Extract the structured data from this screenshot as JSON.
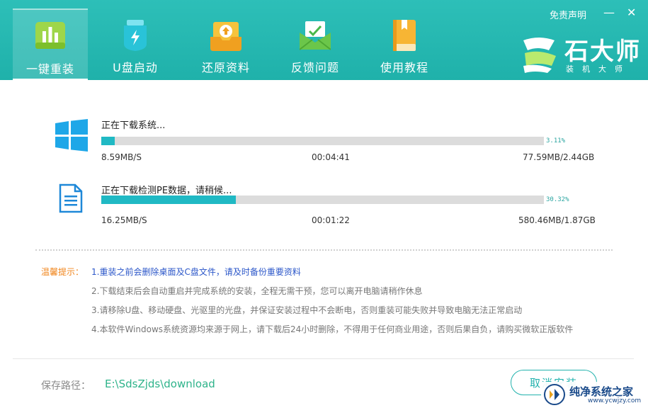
{
  "header": {
    "tabs": [
      {
        "label": "一键重装",
        "icon": "bar-chart-icon",
        "active": true
      },
      {
        "label": "U盘启动",
        "icon": "usb-drive-icon",
        "active": false
      },
      {
        "label": "还原资料",
        "icon": "restore-icon",
        "active": false
      },
      {
        "label": "反馈问题",
        "icon": "mail-feedback-icon",
        "active": false
      },
      {
        "label": "使用教程",
        "icon": "book-icon",
        "active": false
      }
    ],
    "disclaimer": "免责声明",
    "minimize": "—",
    "close": "✕",
    "logo_name": "石大师",
    "logo_sub": "装机大师"
  },
  "downloads": [
    {
      "icon": "windows-icon",
      "title": "正在下载系统...",
      "progress": 0.0311,
      "percent": "3.11%",
      "speed": "8.59MB/S",
      "time": "00:04:41",
      "size": "77.59MB/2.44GB"
    },
    {
      "icon": "document-icon",
      "title": "正在下载检测PE数据，请稍候...",
      "progress": 0.3032,
      "percent": "30.32%",
      "speed": "16.25MB/S",
      "time": "00:01:22",
      "size": "580.46MB/1.87GB"
    }
  ],
  "tips": {
    "label": "温馨提示：",
    "items": [
      "1.重装之前会删除桌面及C盘文件，请及时备份重要资料",
      "2.下载结束后会自动重启并完成系统的安装，全程无需干预，您可以离开电脑请稍作休息",
      "3.请移除U盘、移动硬盘、光驱里的光盘，并保证安装过程中不会断电，否则重装可能失败并导致电脑无法正常启动",
      "4.本软件Windows系统资源均来源于网上，请下载后24小时删除，不得用于任何商业用途，否则后果自负，请购买微软正版软件"
    ]
  },
  "footer": {
    "save_label": "保存路径：",
    "save_path": "E:\\SdsZjds\\download",
    "cancel_label": "取消安装"
  },
  "watermark": {
    "text": "纯净系统之家",
    "url": "www.ycwjzy.com"
  },
  "colors": {
    "header_teal": "#1fb1aa",
    "progress_fill": "#20b9c4",
    "tip_highlight": "#2c57c9",
    "tip_label": "#f0851c",
    "path_green": "#2db38a"
  }
}
